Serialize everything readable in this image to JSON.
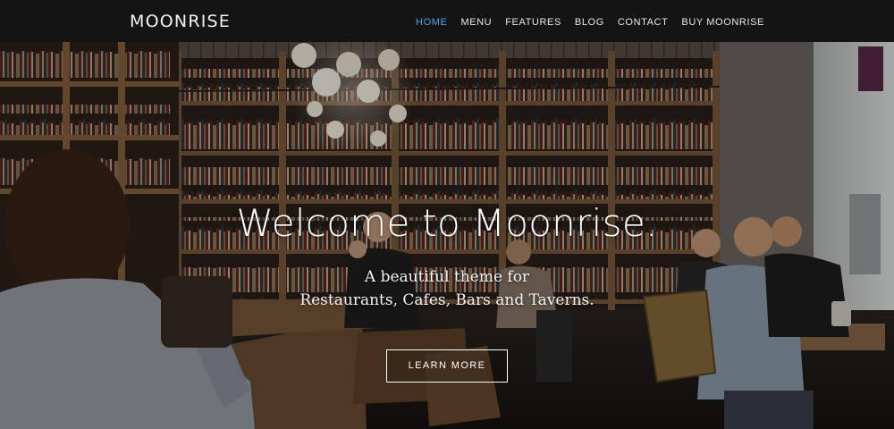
{
  "brand": {
    "logo_text": "MOONRISE"
  },
  "nav": {
    "items": [
      {
        "label": "HOME",
        "active": true
      },
      {
        "label": "MENU",
        "active": false
      },
      {
        "label": "FEATURES",
        "active": false
      },
      {
        "label": "BLOG",
        "active": false
      },
      {
        "label": "CONTACT",
        "active": false
      },
      {
        "label": "BUY MOONRISE",
        "active": false
      }
    ],
    "active_color": "#4fa3e0"
  },
  "hero": {
    "title": "Welcome to Moonrise.",
    "subtitle_line1": "A beautiful theme for",
    "subtitle_line2": "Restaurants, Cafes, Bars and Taverns.",
    "cta_label": "LEARN MORE",
    "background_scene": "cafe-interior-with-bookshelves-photo"
  }
}
